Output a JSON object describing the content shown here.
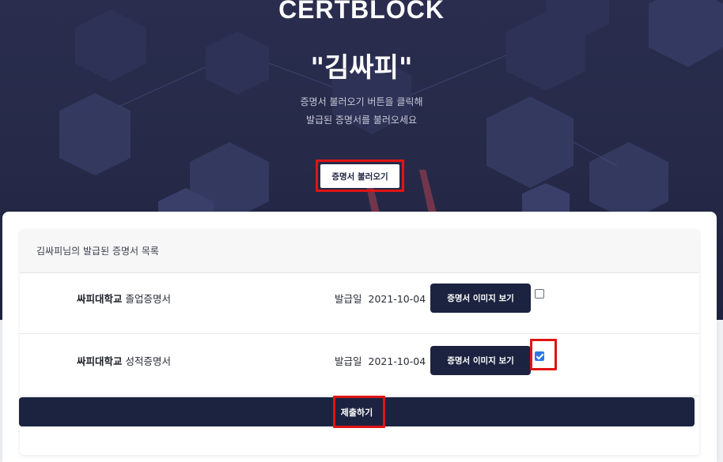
{
  "header": {
    "brand": "CERTBLOCK",
    "user_name": "\"김싸피\"",
    "instruction_line1": "증명서 불러오기 버튼을 클릭해",
    "instruction_line2": "발급된 증명서를 불러오세요",
    "load_button_label": "증명서 불러오기"
  },
  "list": {
    "title": "김싸피님의 발급된 증명서 목록",
    "items": [
      {
        "school": "싸피대학교",
        "cert_type": "졸업증명서",
        "issued_label": "발급일",
        "issued_date": "2021-10-04",
        "view_button_label": "증명서 이미지 보기",
        "checked": false
      },
      {
        "school": "싸피대학교",
        "cert_type": "성적증명서",
        "issued_label": "발급일",
        "issued_date": "2021-10-04",
        "view_button_label": "증명서 이미지 보기",
        "checked": true
      }
    ]
  },
  "submit_label": "제출하기",
  "colors": {
    "hero_bg": "#262a48",
    "button_navy": "#1c2340",
    "highlight_red": "#e01414",
    "checkbox_blue": "#2a78e4"
  }
}
